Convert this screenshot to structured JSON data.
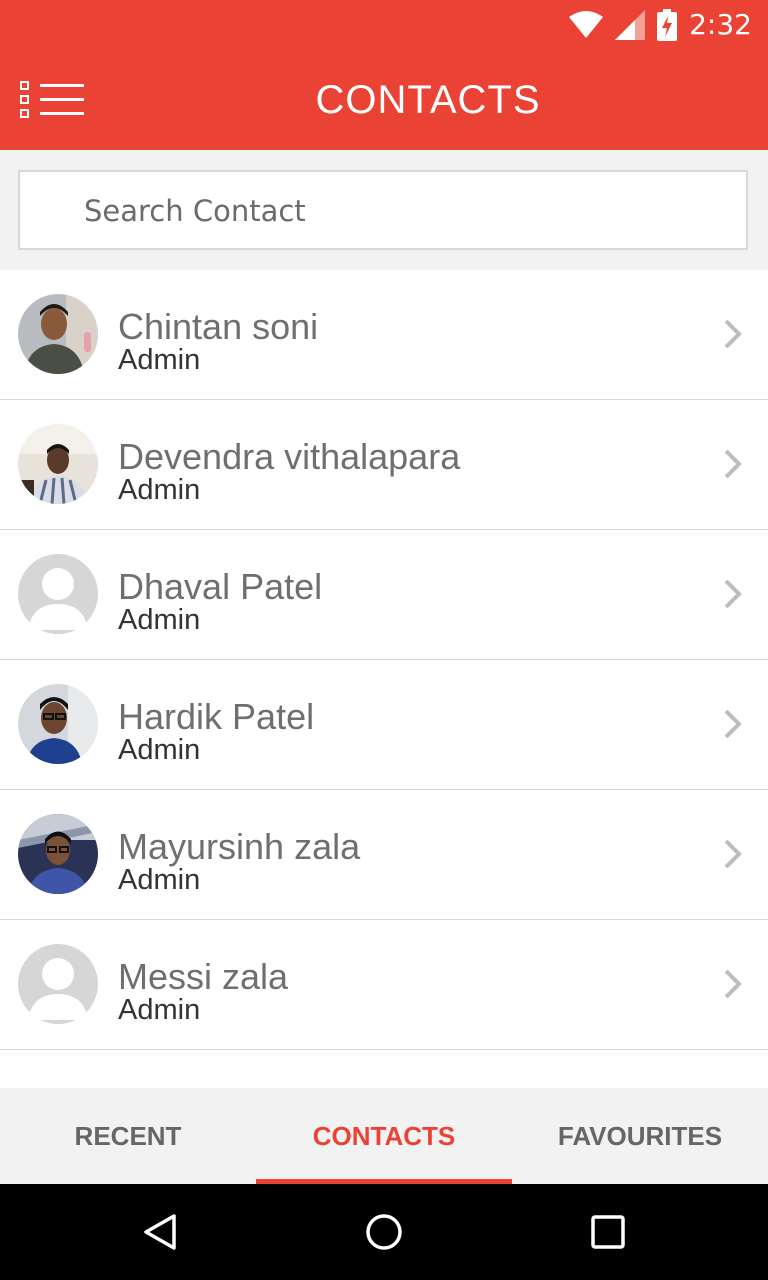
{
  "status_bar": {
    "time": "2:32",
    "icons": [
      "wifi-icon",
      "signal-icon",
      "battery-charging-icon"
    ]
  },
  "app_bar": {
    "title": "CONTACTS",
    "menu_icon": "menu-list-icon",
    "color": "#ea4335"
  },
  "search": {
    "placeholder": "Search Contact",
    "value": ""
  },
  "contacts": [
    {
      "name": "Chintan soni",
      "role": "Admin",
      "avatar": "photo"
    },
    {
      "name": "Devendra vithalapara",
      "role": "Admin",
      "avatar": "photo"
    },
    {
      "name": "Dhaval Patel",
      "role": "Admin",
      "avatar": "placeholder"
    },
    {
      "name": "Hardik Patel",
      "role": "Admin",
      "avatar": "photo"
    },
    {
      "name": "Mayursinh zala",
      "role": "Admin",
      "avatar": "photo"
    },
    {
      "name": "Messi zala",
      "role": "Admin",
      "avatar": "placeholder"
    }
  ],
  "tabs": [
    {
      "label": "RECENT",
      "active": false
    },
    {
      "label": "CONTACTS",
      "active": true
    },
    {
      "label": "FAVOURITES",
      "active": false
    }
  ],
  "nav_bar": {
    "icons": [
      "back-icon",
      "home-icon",
      "recents-icon"
    ]
  },
  "colors": {
    "accent": "#ea4335",
    "background": "#ffffff",
    "tab_bar": "#f2f2f2"
  }
}
